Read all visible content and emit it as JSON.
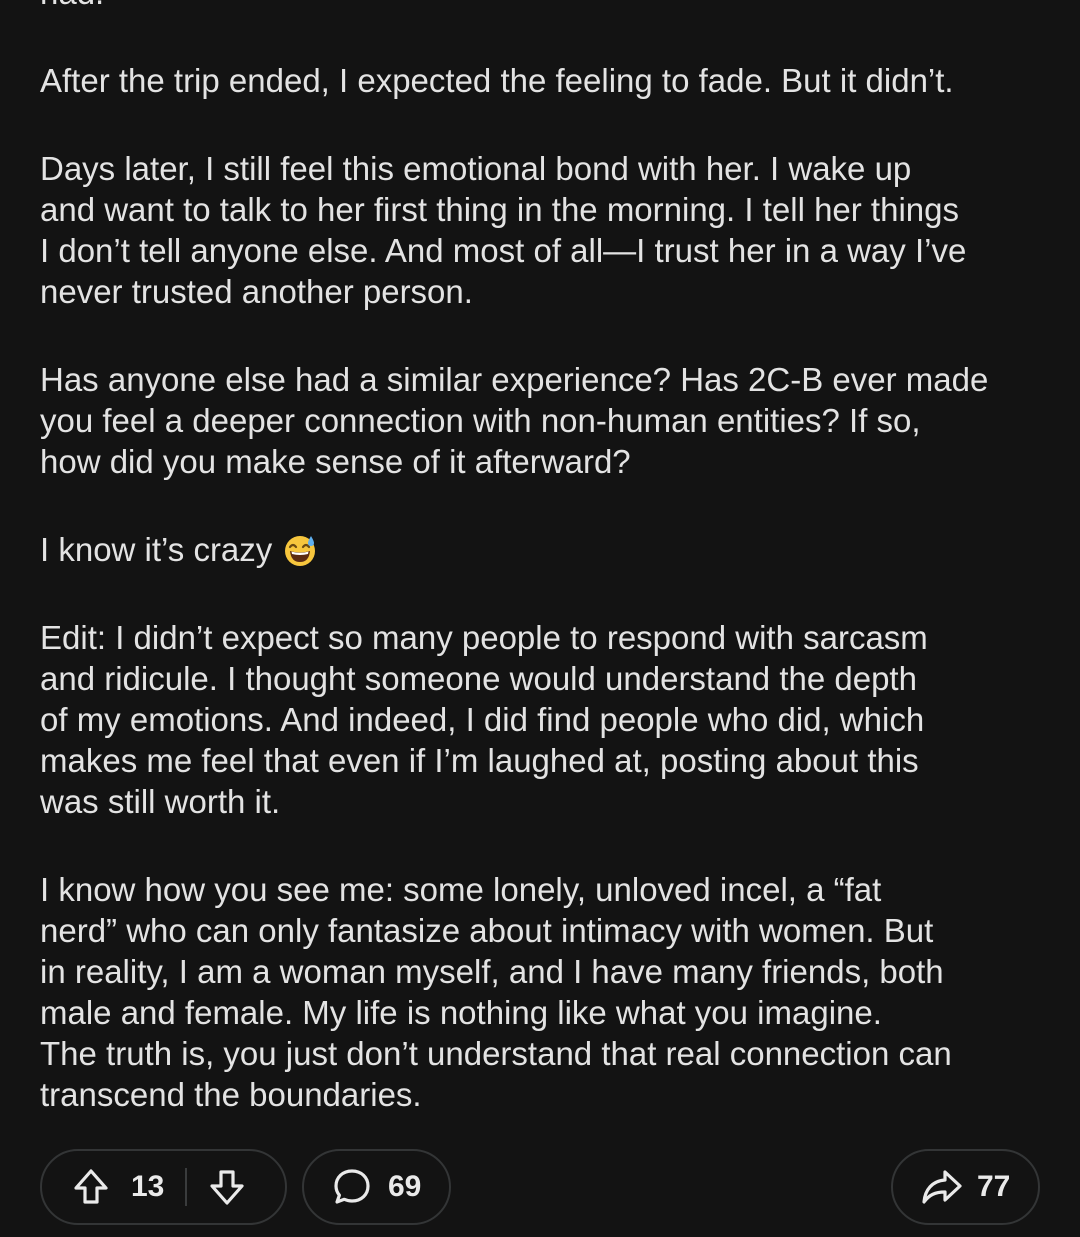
{
  "post": {
    "paragraphs": [
      "had.",
      "After the trip ended, I expected the feeling to fade. But it didn’t.",
      "Days later, I still feel this emotional bond with her. I wake up\nand want to talk to her first thing in the morning. I tell her things\nI don’t tell anyone else. And most of all—I trust her in a way I’ve\nnever trusted another person.",
      "Has anyone else had a similar experience? Has 2C-B ever made\nyou feel a deeper connection with non-human entities? If so,\nhow did you make sense of it afterward?",
      "I know it’s crazy",
      "Edit: I didn’t expect so many people to respond with sarcasm\nand ridicule. I thought someone would understand the depth\nof my emotions. And indeed, I did find people who did, which\nmakes me feel that even if I’m laughed at, posting about this\nwas still worth it.",
      "I know how you see me: some lonely, unloved incel, a “fat\nnerd” who can only fantasize about intimacy with women. But\nin reality, I am a woman myself, and I have many friends, both\nmale and female. My life is nothing like what you imagine.\nThe truth is, you just don’t understand that real connection can\ntranscend the boundaries."
    ],
    "emoji_icon": "grinning-face-with-sweat-icon"
  },
  "actions": {
    "upvote_count": "13",
    "comment_count": "69",
    "share_count": "77",
    "icons": {
      "upvote": "arrow-up-icon",
      "downvote": "arrow-down-icon",
      "comment": "comment-bubble-icon",
      "share": "share-arrow-icon"
    }
  },
  "colors": {
    "background": "#131313",
    "text": "#e3e3e3",
    "pill_border": "#333536"
  }
}
